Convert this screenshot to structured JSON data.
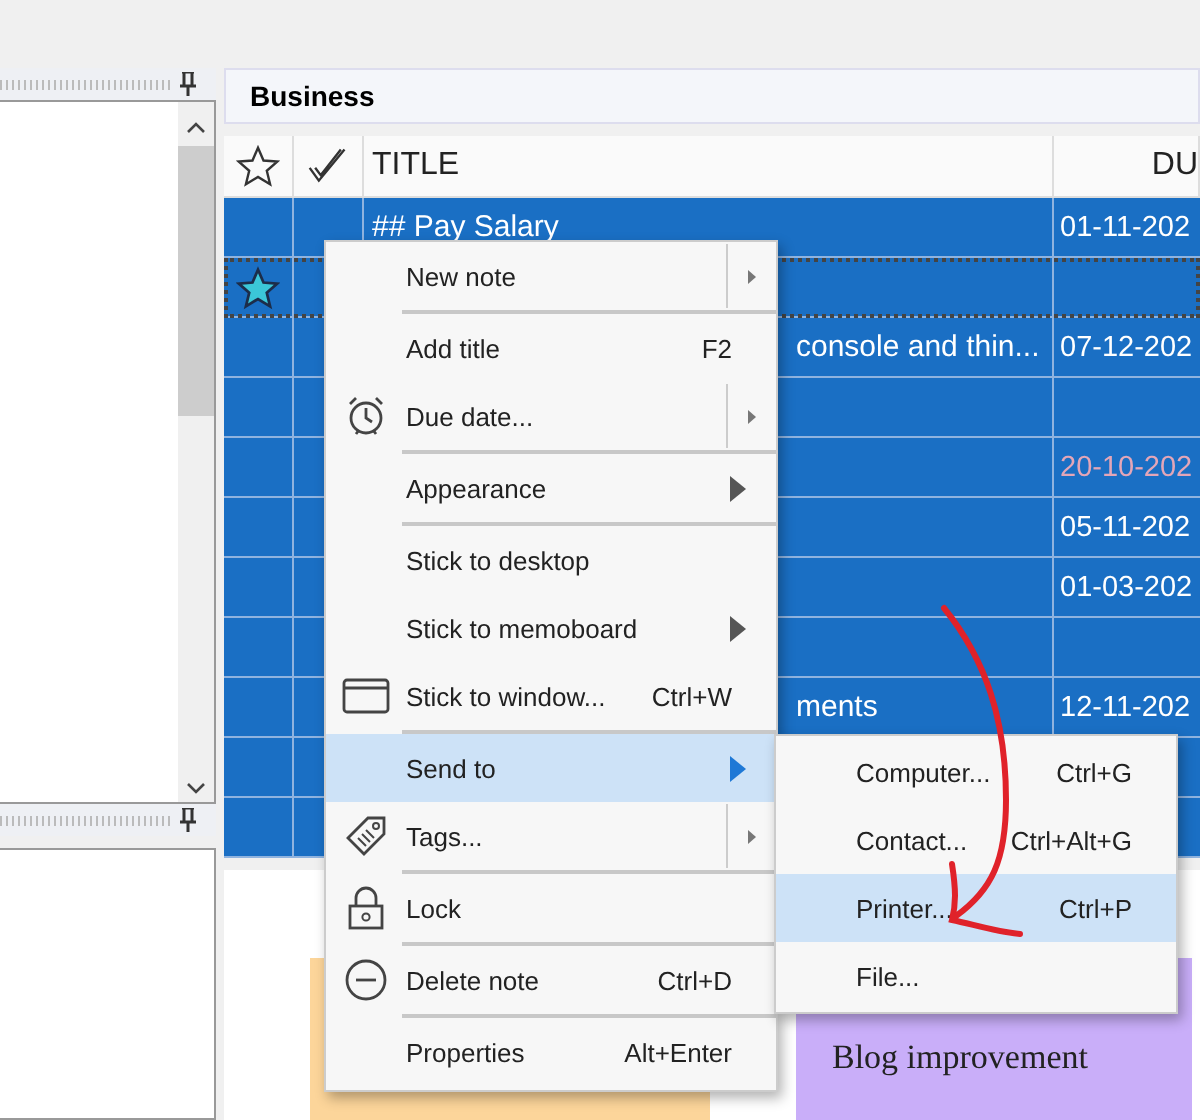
{
  "notebook": {
    "title": "Business"
  },
  "table": {
    "columns": [
      "TITLE",
      "DU"
    ],
    "rows": [
      {
        "title": "## Pay Salary",
        "due": "01-11-202",
        "selected": true,
        "starred": false,
        "focused": false,
        "overdue": false
      },
      {
        "selected": true,
        "starred": true,
        "focused": true
      },
      {
        "title": "console and thin...",
        "due": "07-12-202",
        "selected": true,
        "starred": false,
        "focused": false,
        "overdue": false
      },
      {
        "selected": true,
        "starred": false,
        "focused": false
      },
      {
        "due": "20-10-202",
        "selected": true,
        "starred": false,
        "focused": false,
        "overdue": true
      },
      {
        "due": "05-11-202",
        "selected": true,
        "starred": false,
        "focused": false,
        "overdue": false
      },
      {
        "due": "01-03-202",
        "selected": true,
        "starred": false,
        "focused": false,
        "overdue": false
      },
      {
        "selected": true,
        "starred": false,
        "focused": false
      },
      {
        "title": "ments",
        "due": "12-11-202",
        "selected": true,
        "starred": false,
        "focused": false,
        "overdue": false
      },
      {
        "selected": true,
        "starred": false,
        "focused": false
      },
      {
        "selected": true,
        "starred": false,
        "focused": false
      }
    ]
  },
  "notes": [
    {
      "color": "#fcd59a"
    },
    {
      "title": "Blog improvement",
      "color": "#c9aef9"
    }
  ],
  "context_menu": {
    "items": [
      {
        "label": "New note",
        "kind": "split",
        "separator": false,
        "selected": false
      },
      {
        "label": "Add title",
        "shortcut": "F2",
        "kind": "plain",
        "separator": true,
        "selected": false
      },
      {
        "label": "Due date...",
        "kind": "split",
        "separator": false,
        "selected": false
      },
      {
        "label": "Appearance",
        "kind": "arrow",
        "separator": true,
        "selected": false
      },
      {
        "label": "Stick to desktop",
        "kind": "plain",
        "separator": true,
        "selected": false
      },
      {
        "label": "Stick to memoboard",
        "kind": "arrow",
        "separator": false,
        "selected": false
      },
      {
        "label": "Stick to window...",
        "shortcut": "Ctrl+W",
        "kind": "plain",
        "separator": false,
        "selected": false
      },
      {
        "label": "Send to",
        "kind": "arrow",
        "separator": true,
        "selected": true
      },
      {
        "label": "Tags...",
        "kind": "split",
        "separator": false,
        "selected": false
      },
      {
        "label": "Lock",
        "kind": "plain",
        "separator": true,
        "selected": false
      },
      {
        "label": "Delete note",
        "shortcut": "Ctrl+D",
        "kind": "plain",
        "separator": true,
        "selected": false
      },
      {
        "label": "Properties",
        "shortcut": "Alt+Enter",
        "kind": "plain",
        "separator": true,
        "selected": false
      }
    ]
  },
  "submenu": {
    "items": [
      {
        "label": "Computer...",
        "shortcut": "Ctrl+G",
        "selected": false
      },
      {
        "label": "Contact...",
        "shortcut": "Ctrl+Alt+G",
        "selected": false
      },
      {
        "label": "Printer...",
        "shortcut": "Ctrl+P",
        "selected": true
      },
      {
        "label": "File...",
        "selected": false
      }
    ]
  }
}
